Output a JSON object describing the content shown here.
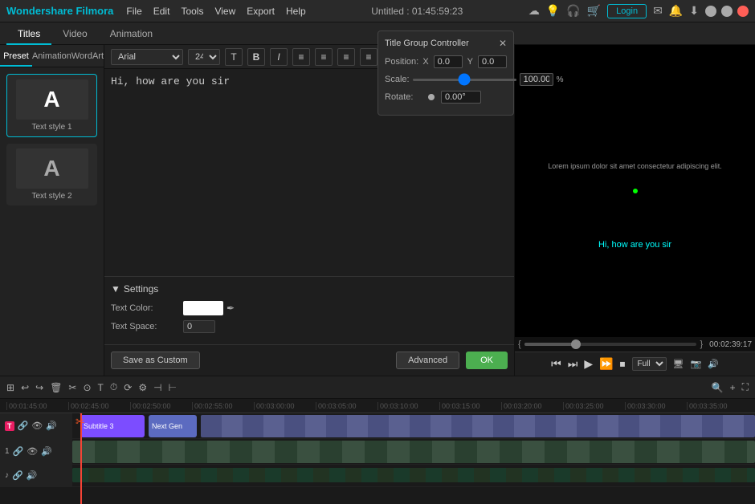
{
  "app": {
    "name": "Wondershare Filmora",
    "title": "Untitled : 01:45:59:23"
  },
  "menu": {
    "items": [
      "File",
      "Edit",
      "Tools",
      "View",
      "Export",
      "Help"
    ]
  },
  "nav_tabs": [
    "Titles",
    "Video",
    "Animation"
  ],
  "active_nav_tab": "Titles",
  "sub_tabs": [
    "Preset",
    "Animation",
    "WordArt"
  ],
  "active_sub_tab": "Preset",
  "styles": [
    {
      "label": "Text style 1",
      "letter": "A"
    },
    {
      "label": "Text style 2",
      "letter": "A"
    }
  ],
  "toolbar": {
    "font": "Arial",
    "size": "24",
    "bold_label": "B",
    "italic_label": "I",
    "align_icons": [
      "≡",
      "≡",
      "≡",
      "≡"
    ]
  },
  "text_content": "Hi, how are you sir",
  "settings": {
    "header": "Settings",
    "text_color_label": "Text Color:",
    "text_space_label": "Text Space:",
    "text_space_value": "0"
  },
  "buttons": {
    "save_custom": "Save as Custom",
    "advanced": "Advanced",
    "ok": "OK"
  },
  "popup": {
    "title": "Title Group Controller",
    "position_label": "Position:",
    "x_label": "X",
    "x_value": "0.0",
    "y_label": "Y",
    "y_value": "0.0",
    "scale_label": "Scale:",
    "scale_value": "100.00",
    "scale_pct": "%",
    "rotate_label": "Rotate:",
    "rotate_value": "0.00°"
  },
  "preview": {
    "main_text": "Lorem ipsum dolor sit amet consectetur adipiscing elit.",
    "subtitle_text": "Hi, how are you sir",
    "time": "00:02:39:17"
  },
  "playback": {
    "quality": "Full"
  },
  "timeline": {
    "rulers": [
      "00:01:45:00",
      "00:02:45:00",
      "00:02:50:00",
      "00:02:55:00",
      "00:03:00:00",
      "00:03:05:00",
      "00:03:10:00",
      "00:03:15:00",
      "00:03:20:00",
      "00:03:25:00",
      "00:03:30:00",
      "00:03:35:00"
    ],
    "tracks": [
      {
        "type": "title",
        "clip_label": "Subtitle 3",
        "next_label": "Next Gen"
      },
      {
        "type": "video"
      }
    ]
  }
}
